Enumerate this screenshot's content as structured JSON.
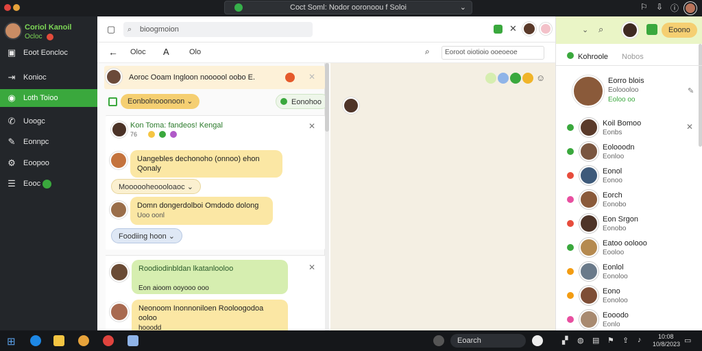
{
  "window": {
    "title": "Coct Soml: Nodor ooronoou f Soloi",
    "colors": {
      "accent": "#3aa83d",
      "titlebar": "#1b1d20",
      "sidebar": "#23262a"
    }
  },
  "profile": {
    "name": "Coriol Kanoil",
    "status": "Ocloc"
  },
  "nav": [
    {
      "label": "Eoot Eoncloc",
      "icon": "window-icon"
    },
    {
      "label": "Konioc",
      "icon": "exit-icon"
    },
    {
      "label": "Loth Toioo",
      "icon": "chat-icon"
    },
    {
      "label": "Uoogc",
      "icon": "phone-icon"
    },
    {
      "label": "Eonnpc",
      "icon": "tool-icon"
    },
    {
      "label": "Eoopoo",
      "icon": "gear-icon"
    },
    {
      "label": "Eooc",
      "icon": "list-icon"
    }
  ],
  "toolbar": {
    "search_placeholder": "bioogmoion"
  },
  "subbar": {
    "tab1": "Oloc",
    "tab2": "Olo",
    "search_placeholder": "Eoroot oiotioio ooeoeoe"
  },
  "chat": {
    "banner_text": "Aoroc Ooam Ingloon noooool oobo E.",
    "pill1": "Eonbolnooonoon",
    "pill2": "Eonohoo",
    "card1": {
      "title": "Kon Toma: fandeos! Kengal",
      "meta": "76",
      "bubble1": "Uangebles dechonoho (onnoo) ehon Qonaly",
      "pill": "Moooooheoooloaoc",
      "bubble2": "Domn dongerdolboi Omdodo dolong",
      "bubble2_sub": "Uoo oonl",
      "pill2": "Foodiing hoon"
    },
    "card2": {
      "title": "Roodiodinbldan lkatanlooloo",
      "meta": "Eon aioom ooyooo ooo",
      "bubble": "Neonoom Inonnoniloen Rooloogodoa ooloo",
      "bubble_sub": "hooodd"
    }
  },
  "right": {
    "top_button": "Eoono",
    "tab1": "Kohroole",
    "tab2": "Nobos",
    "header": {
      "name": "Eorro blois",
      "line1": "Eoloooloo",
      "line2": "Eoloo oo"
    },
    "contacts": [
      {
        "name": "Koil Bomoo",
        "sub": "Eonbs",
        "dot": "#3aa83d"
      },
      {
        "name": "Eolooodn",
        "sub": "Eonloo",
        "dot": "#3aa83d"
      },
      {
        "name": "Eonol",
        "sub": "Eonoo",
        "dot": "#e74c3c"
      },
      {
        "name": "Eorch",
        "sub": "Eonobo",
        "dot": "#e84fa0"
      },
      {
        "name": "Eon Srgon",
        "sub": "Eonobo",
        "dot": "#e74c3c"
      },
      {
        "name": "Eatoo oolooo",
        "sub": "Eooloo",
        "dot": "#3aa83d"
      },
      {
        "name": "Eonlol",
        "sub": "Eonoloo",
        "dot": "#f39c12"
      },
      {
        "name": "Eono",
        "sub": "Eonoloo",
        "dot": "#f39c12"
      },
      {
        "name": "Eooodo",
        "sub": "Eonlo",
        "dot": "#e84fa0"
      }
    ]
  },
  "taskbar": {
    "search": "Eoarch",
    "time": "10:08",
    "date": "10/8/2023"
  }
}
